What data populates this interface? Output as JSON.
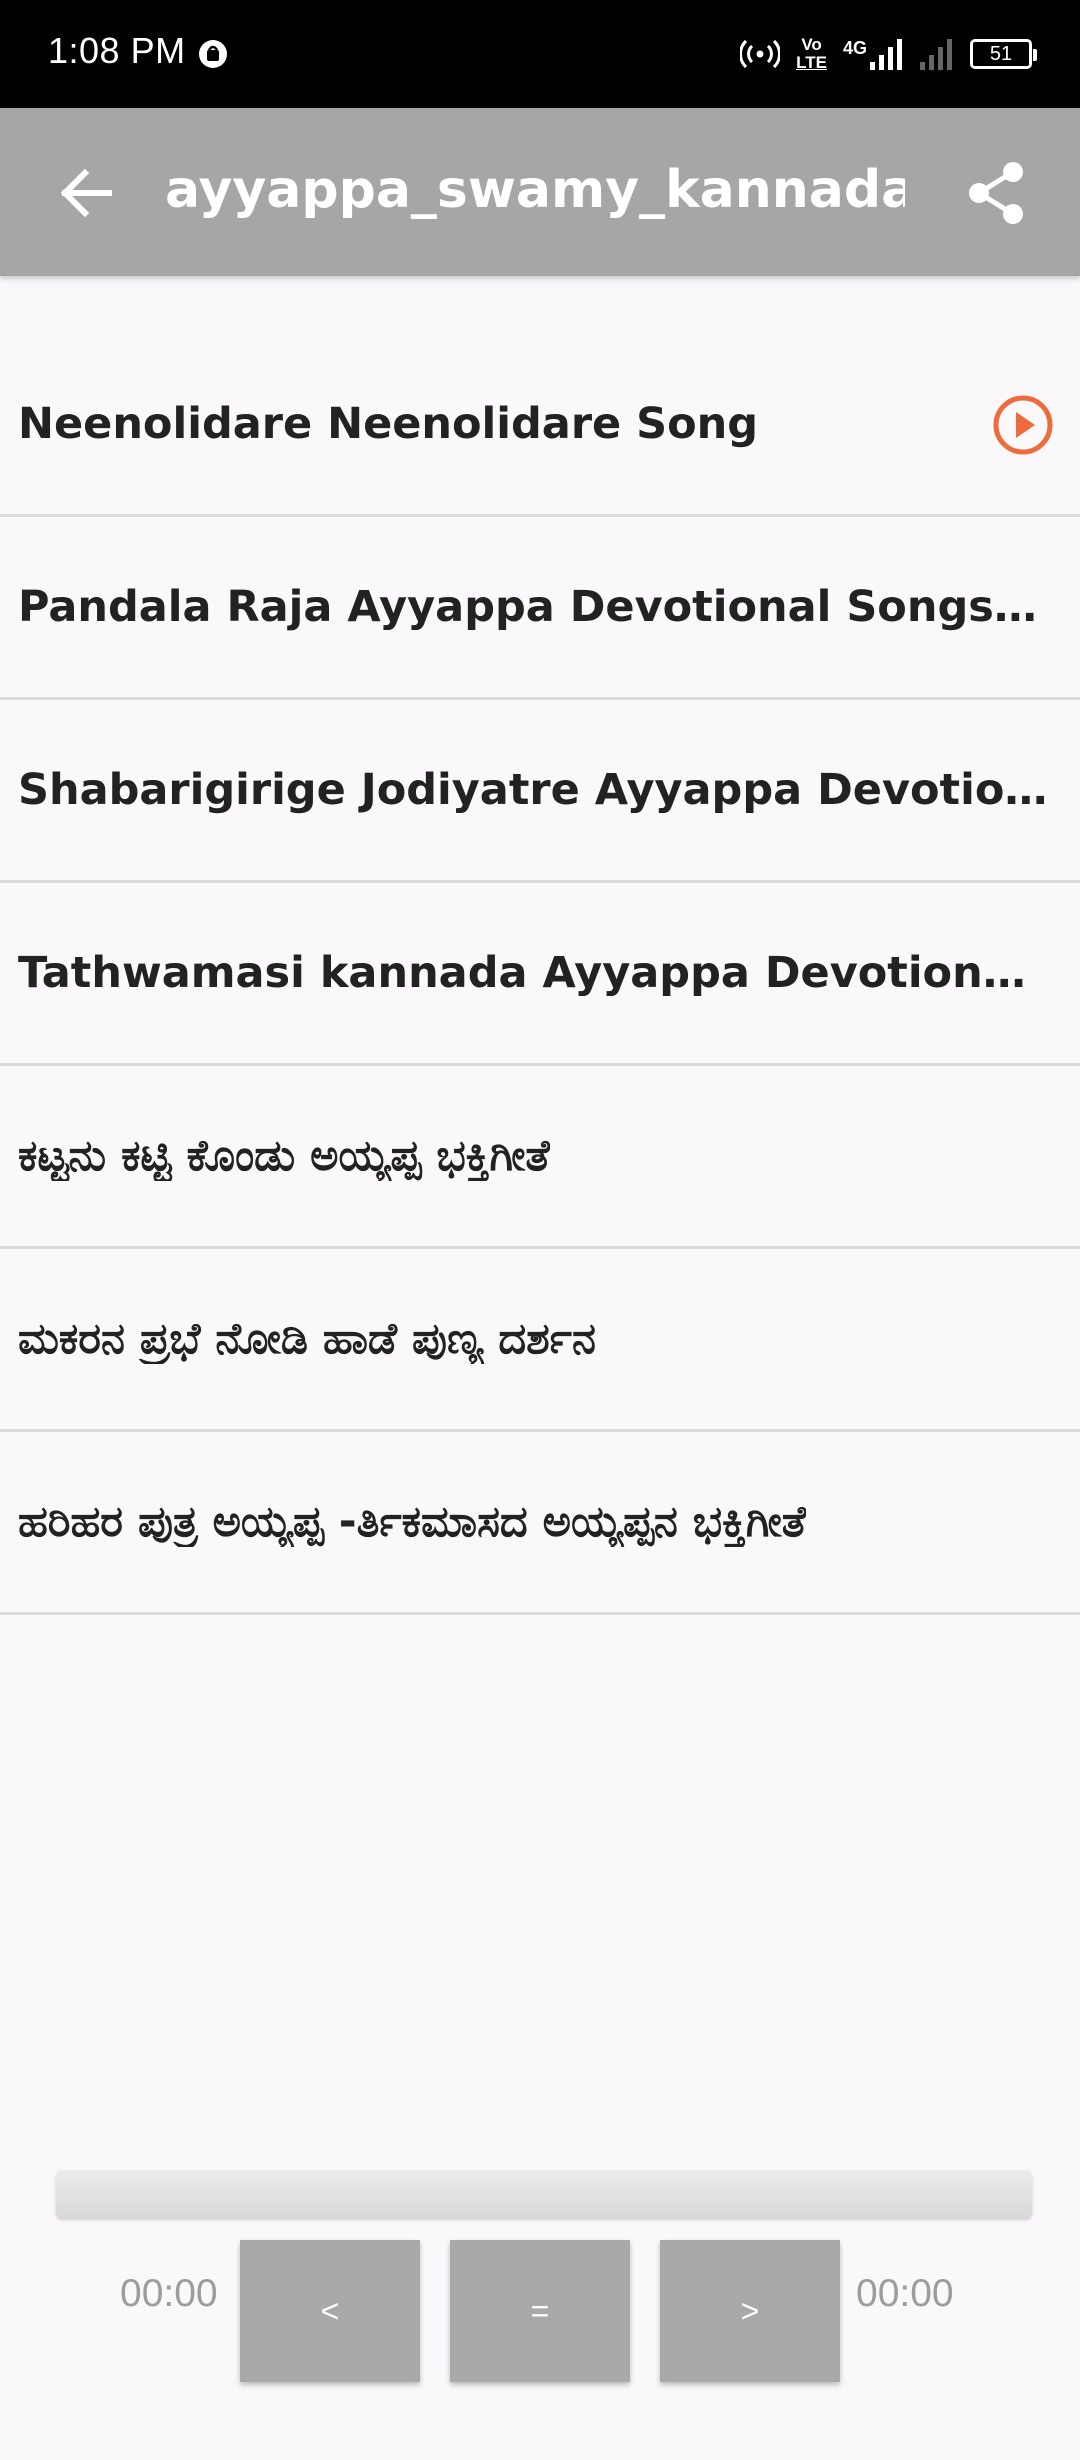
{
  "status_bar": {
    "time": "1:08 PM",
    "battery": "51",
    "icons": [
      "app-notification-icon",
      "hotspot-icon",
      "volte-icon",
      "4g-signal-icon",
      "signal-icon",
      "battery-icon"
    ],
    "volte_top": "Vo",
    "volte_bottom": "LTE",
    "network": "4G"
  },
  "app_bar": {
    "title": "ayyappa_swamy_kannada_",
    "back_icon": "arrow-back-icon",
    "share_icon": "share-icon"
  },
  "songs": [
    {
      "title": "Neenolidare Neenolidare Song"
    },
    {
      "title": "Pandala Raja Ayyappa Devotional Songs Kannada"
    },
    {
      "title": "Shabarigirige Jodiyatre  Ayyappa Devotional Song"
    },
    {
      "title": "Tathwamasi kannada Ayyappa Devotional song"
    },
    {
      "title": "ಕಟ್ಟನು ಕಟ್ಟಿ ಕೊಂಡು  ಅಯ್ಯಪ್ಪ ಭಕ್ತಿಗೀತೆ"
    },
    {
      "title": "ಮಕರನ ಪ್ರಭೆ ನೋಡಿ ಹಾಡೆ ಪುಣ್ಯ ದರ್ಶನ"
    },
    {
      "title": "ಹರಿಹರ ಪುತ್ರ ಅಯ್ಯಪ್ಪ  -ರ್ತಿಕಮಾಸದ ಅಯ್ಯಪ್ಪನ ಭಕ್ತಿಗೀತೆ"
    }
  ],
  "colors": {
    "accent": "#ee6b3b",
    "app_bar": "#a6a6a6",
    "button": "#a9a9a9"
  },
  "player": {
    "current_time": "00:00",
    "total_time": "00:00",
    "prev_label": "<",
    "pause_label": "=",
    "next_label": ">",
    "progress": 0
  }
}
